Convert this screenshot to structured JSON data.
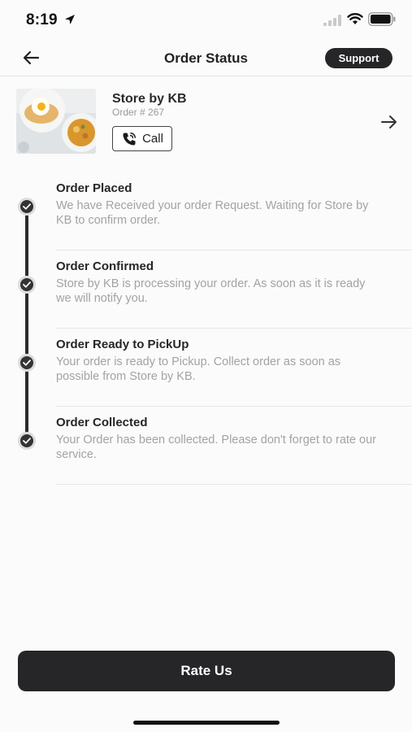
{
  "status_bar": {
    "time": "8:19",
    "icons": [
      "location-arrow-icon",
      "signal-bars-icon",
      "wifi-icon",
      "battery-icon"
    ]
  },
  "nav": {
    "back_icon": "arrow-left-icon",
    "title": "Order Status",
    "support_label": "Support"
  },
  "store": {
    "name": "Store by KB",
    "order_number": "Order # 267",
    "call_label": "Call",
    "call_icon": "phone-icon",
    "arrow_icon": "arrow-right-icon"
  },
  "timeline": {
    "steps": [
      {
        "title": "Order Placed",
        "description": "We have Received your order Request. Waiting for Store by KB to confirm order.",
        "completed": true
      },
      {
        "title": "Order Confirmed",
        "description": "Store by KB is processing your order. As soon as it is ready we will notify you.",
        "completed": true
      },
      {
        "title": "Order Ready to PickUp",
        "description": "Your order is ready to Pickup. Collect order as soon as possible from Store by KB.",
        "completed": true
      },
      {
        "title": "Order Collected",
        "description": "Your Order has been collected. Please don't forget to rate our service.",
        "completed": true
      }
    ]
  },
  "footer": {
    "rate_label": "Rate Us"
  },
  "colors": {
    "primary_dark": "#262628",
    "muted_text": "#a3a3a3",
    "background": "#fbfbfb"
  }
}
